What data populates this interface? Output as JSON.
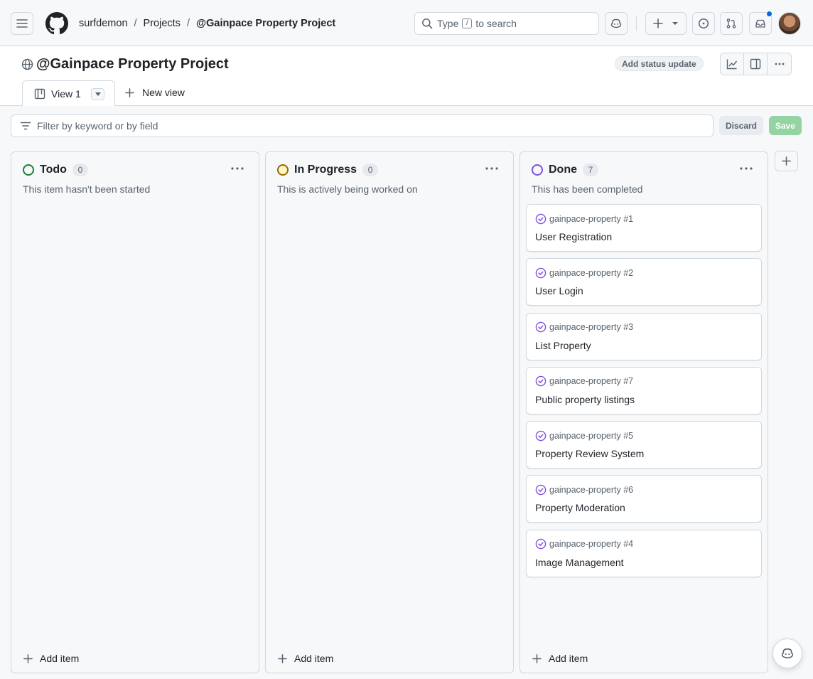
{
  "nav": {
    "breadcrumbs": [
      {
        "label": "surfdemon"
      },
      {
        "label": "Projects"
      },
      {
        "label": "@Gainpace Property Project"
      }
    ],
    "search": {
      "prefix": "Type",
      "shortcut": "/",
      "suffix": "to search"
    }
  },
  "project": {
    "title": "@Gainpace Property Project",
    "status_update_label": "Add status update"
  },
  "tabs": {
    "active_label": "View 1",
    "new_view_label": "New view"
  },
  "filter": {
    "placeholder": "Filter by keyword or by field",
    "discard_label": "Discard",
    "save_label": "Save"
  },
  "columns": [
    {
      "name": "Todo",
      "count": "0",
      "description": "This item hasn't been started",
      "color": "#1a7f37",
      "add_label": "Add item",
      "cards": []
    },
    {
      "name": "In Progress",
      "count": "0",
      "description": "This is actively being worked on",
      "color": "#9a6700",
      "add_label": "Add item",
      "cards": []
    },
    {
      "name": "Done",
      "count": "7",
      "description": "This has been completed",
      "color": "#8250df",
      "add_label": "Add item",
      "cards": [
        {
          "ref": "gainpace-property #1",
          "title": "User Registration"
        },
        {
          "ref": "gainpace-property #2",
          "title": "User Login"
        },
        {
          "ref": "gainpace-property #3",
          "title": "List Property"
        },
        {
          "ref": "gainpace-property #7",
          "title": "Public property listings"
        },
        {
          "ref": "gainpace-property #5",
          "title": "Property Review System"
        },
        {
          "ref": "gainpace-property #6",
          "title": "Property Moderation"
        },
        {
          "ref": "gainpace-property #4",
          "title": "Image Management"
        }
      ]
    }
  ],
  "colors": {
    "done": "#8250df",
    "todo": "#1a7f37",
    "in_progress": "#9a6700",
    "accent": "#0969da",
    "save": "#94d3a2"
  }
}
